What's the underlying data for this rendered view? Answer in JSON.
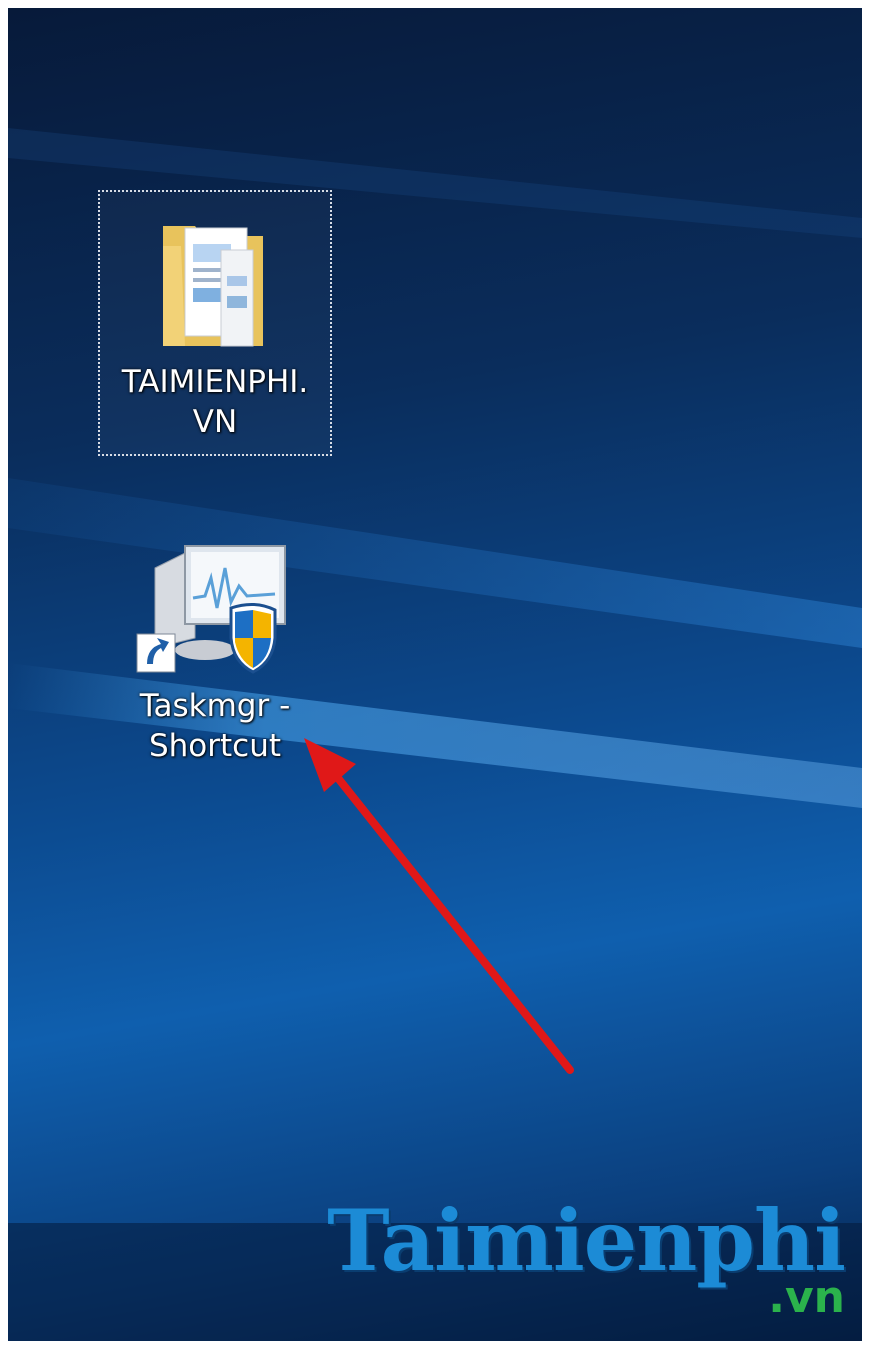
{
  "desktop": {
    "icons": [
      {
        "label": "TAIMIENPHI.\nVN",
        "type": "folder",
        "icon": "folder-icon",
        "selected": true
      },
      {
        "label": "Taskmgr -\nShortcut",
        "type": "shortcut",
        "icon": "task-manager-icon",
        "overlay": "shortcut-arrow-icon"
      }
    ]
  },
  "annotation": {
    "arrow_color": "#e01818"
  },
  "watermark": {
    "main": "Taimienphi",
    "tld": ".vn",
    "main_color": "#1c8bd6",
    "tld_color": "#2bb24c"
  },
  "colors": {
    "accent": "#0f5fae",
    "label_text": "#ffffff"
  }
}
